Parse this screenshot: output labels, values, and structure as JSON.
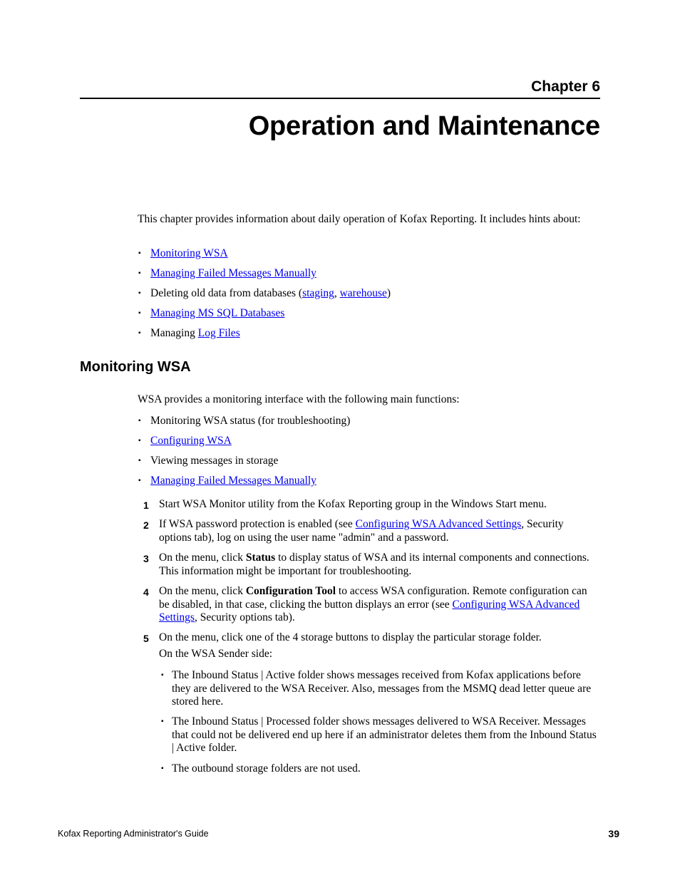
{
  "header": {
    "chapter_label": "Chapter 6",
    "title": "Operation and Maintenance"
  },
  "intro": {
    "text": "This chapter provides information about daily operation of Kofax Reporting. It includes hints about:",
    "bullets": [
      {
        "link": "Monitoring WSA"
      },
      {
        "link": "Managing Failed Messages Manually"
      },
      {
        "prefix": "Deleting old data from databases (",
        "link1": "staging",
        "sep": ", ",
        "link2": "warehouse",
        "suffix": ")"
      },
      {
        "link": "Managing MS SQL Databases"
      },
      {
        "prefix": "Managing ",
        "link": "Log Files"
      }
    ]
  },
  "section": {
    "heading": "Monitoring WSA",
    "intro": "WSA provides a monitoring interface with the following main functions:",
    "bullets": [
      {
        "text": "Monitoring WSA status (for troubleshooting)"
      },
      {
        "link": "Configuring WSA"
      },
      {
        "text": "Viewing messages in storage"
      },
      {
        "link": "Managing Failed Messages Manually"
      }
    ],
    "steps": [
      {
        "num": "1",
        "text": "Start WSA Monitor utility from the Kofax Reporting group in the Windows Start menu."
      },
      {
        "num": "2",
        "prefix": "If WSA password protection is enabled (see ",
        "link": "Configuring WSA Advanced Settings",
        "suffix": ", Security options tab), log on using the user name \"admin\" and a password."
      },
      {
        "num": "3",
        "prefix": "On the menu, click ",
        "bold": "Status",
        "suffix": " to display status of WSA and its internal components and connections. This information might be important for troubleshooting."
      },
      {
        "num": "4",
        "prefix": "On the menu, click ",
        "bold": "Configuration Tool",
        "middle": " to access WSA configuration. Remote configuration can be disabled, in that case, clicking the button displays an error (see ",
        "link": "Configuring WSA Advanced Settings",
        "suffix": ", Security options tab)."
      },
      {
        "num": "5",
        "text": "On the menu, click one of the 4 storage buttons to display the particular storage folder.",
        "subtext": "On the WSA Sender side:"
      }
    ],
    "sub_bullets": [
      "The Inbound Status | Active folder shows messages received from Kofax applications before they are delivered to the WSA Receiver. Also, messages from the MSMQ dead letter queue are stored here.",
      "The Inbound Status | Processed folder shows messages delivered to WSA Receiver. Messages that could not be delivered end up here if an administrator deletes them from the Inbound Status | Active folder.",
      "The outbound storage folders are not used."
    ]
  },
  "footer": {
    "doc_title": "Kofax Reporting Administrator's Guide",
    "page_number": "39"
  },
  "icons": {
    "bullet": "▪"
  }
}
